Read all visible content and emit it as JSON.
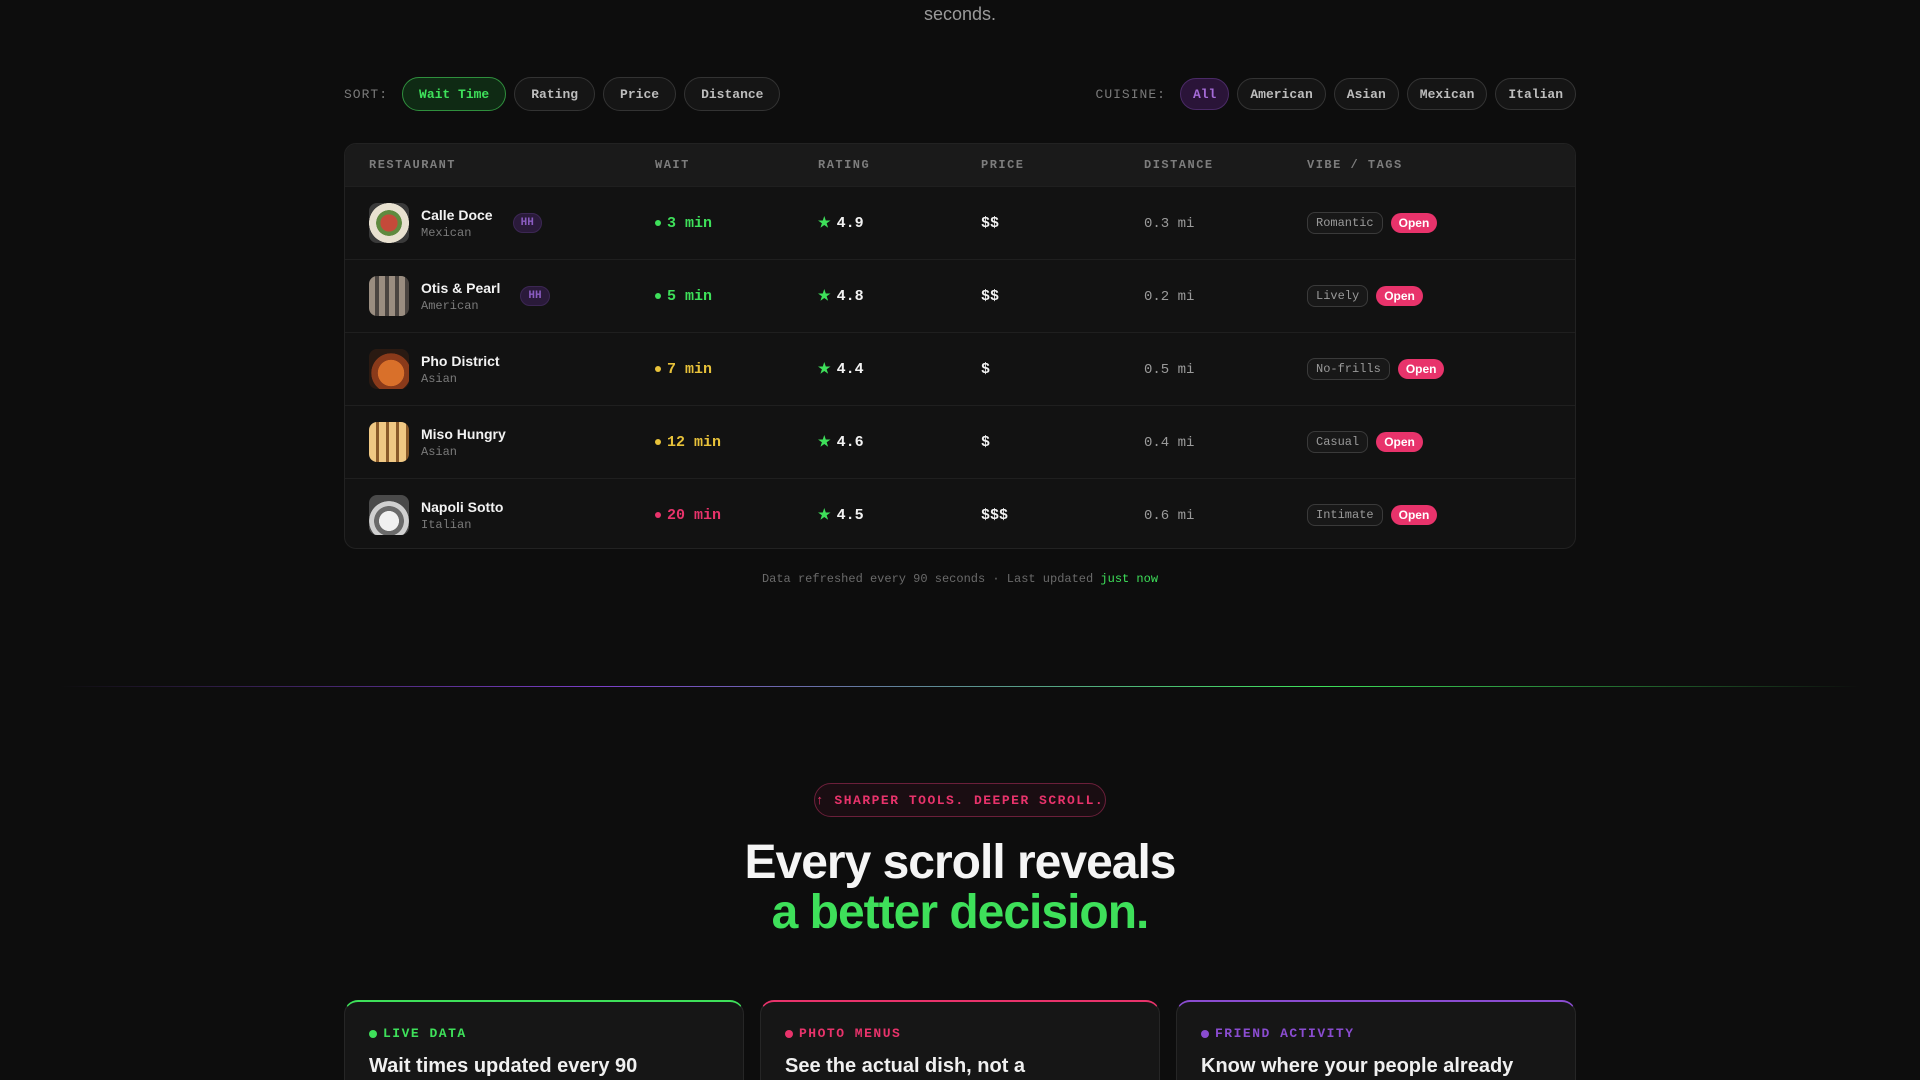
{
  "intro_tail": "seconds.",
  "sort": {
    "label": "SORT:",
    "options": [
      "Wait Time",
      "Rating",
      "Price",
      "Distance"
    ],
    "selected": "Wait Time"
  },
  "cuisine": {
    "label": "CUISINE:",
    "options": [
      "All",
      "American",
      "Asian",
      "Mexican",
      "Italian"
    ],
    "selected": "All"
  },
  "table": {
    "headers": [
      "RESTAURANT",
      "WAIT",
      "RATING",
      "PRICE",
      "DISTANCE",
      "VIBE / TAGS"
    ],
    "rows": [
      {
        "name": "Calle Doce",
        "cuisine": "Mexican",
        "badge": "HH",
        "wait": "3 min",
        "wait_color": "#3ee05a",
        "rating": "4.9",
        "price": "$$",
        "distance": "0.3 mi",
        "tag": "Romantic",
        "status": "Open"
      },
      {
        "name": "Otis & Pearl",
        "cuisine": "American",
        "badge": "HH",
        "wait": "5 min",
        "wait_color": "#3ee05a",
        "rating": "4.8",
        "price": "$$",
        "distance": "0.2 mi",
        "tag": "Lively",
        "status": "Open"
      },
      {
        "name": "Pho District",
        "cuisine": "Asian",
        "badge": "",
        "wait": "7 min",
        "wait_color": "#e8c23a",
        "rating": "4.4",
        "price": "$",
        "distance": "0.5 mi",
        "tag": "No-frills",
        "status": "Open"
      },
      {
        "name": "Miso Hungry",
        "cuisine": "Asian",
        "badge": "",
        "wait": "12 min",
        "wait_color": "#e8c23a",
        "rating": "4.6",
        "price": "$",
        "distance": "0.4 mi",
        "tag": "Casual",
        "status": "Open"
      },
      {
        "name": "Napoli Sotto",
        "cuisine": "Italian",
        "badge": "",
        "wait": "20 min",
        "wait_color": "#e8336b",
        "rating": "4.5",
        "price": "$$$",
        "distance": "0.6 mi",
        "tag": "Intimate",
        "status": "Open"
      }
    ]
  },
  "refresh": {
    "text": "Data refreshed every 90 seconds · Last updated",
    "highlight": "just now"
  },
  "section": {
    "pill": "↑ SHARPER TOOLS. DEEPER SCROLL.",
    "headline_1": "Every scroll reveals",
    "headline_2": "a better decision."
  },
  "cards": [
    {
      "label": "LIVE DATA",
      "title": "Wait times updated every 90",
      "color": "#3ee05a"
    },
    {
      "label": "PHOTO MENUS",
      "title": "See the actual dish, not a",
      "color": "#e8336b"
    },
    {
      "label": "FRIEND ACTIVITY",
      "title": "Know where your people already",
      "color": "#8a4cd0"
    }
  ],
  "colors": {
    "green": "#3ee05a",
    "pink": "#e8336b",
    "purple": "#8a4cd0",
    "background": "#0d0d0d"
  }
}
